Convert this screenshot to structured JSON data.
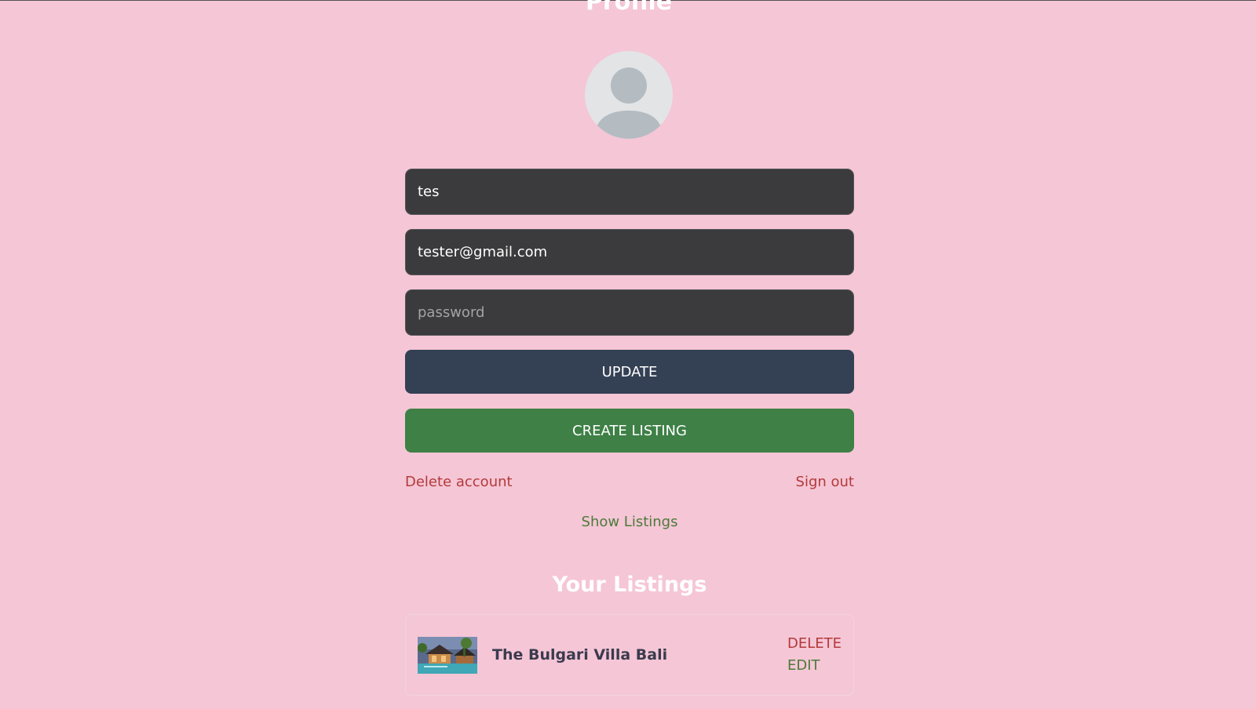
{
  "page": {
    "title": "Profile"
  },
  "form": {
    "username_value": "tes",
    "email_value": "tester@gmail.com",
    "password_placeholder": "password",
    "update_label": "UPDATE",
    "create_listing_label": "CREATE LISTING"
  },
  "account_links": {
    "delete_account": "Delete account",
    "sign_out": "Sign out"
  },
  "show_listings_label": "Show Listings",
  "listings": {
    "title": "Your Listings",
    "items": [
      {
        "name": "The Bulgari Villa Bali",
        "delete_label": "DELETE",
        "edit_label": "EDIT"
      }
    ]
  },
  "colors": {
    "background": "#f5c6d6",
    "update_button": "#344054",
    "create_button": "#3e8046",
    "danger_text": "#b33a3a",
    "success_text": "#4c7a3a"
  },
  "icons": {
    "avatar": "user-avatar-icon"
  }
}
